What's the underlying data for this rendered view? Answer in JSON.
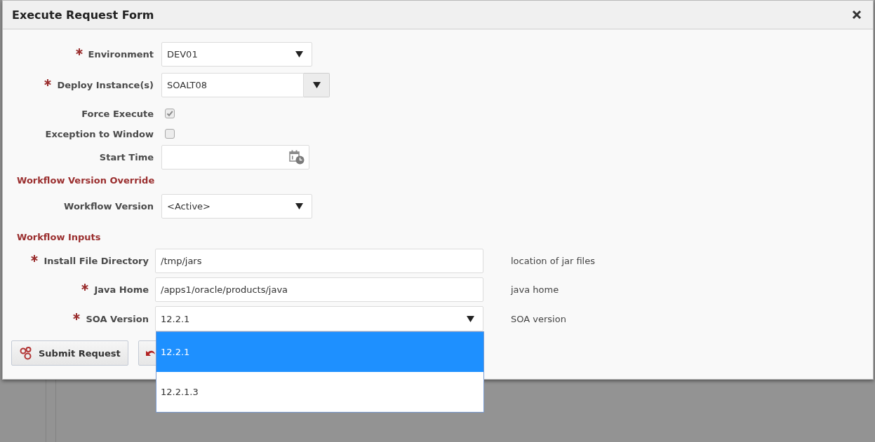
{
  "dialog": {
    "title": "Execute Request Form"
  },
  "main_fields": [
    {
      "kind": "select",
      "label": "Environment",
      "required": true,
      "value": "DEV01"
    },
    {
      "kind": "combo",
      "label": "Deploy Instance(s)",
      "required": true,
      "value": "SOALT08"
    },
    {
      "kind": "checkbox",
      "label": "Force Execute",
      "required": false,
      "checked": true
    },
    {
      "kind": "checkbox",
      "label": "Exception to Window",
      "required": false,
      "checked": false
    },
    {
      "kind": "datetime",
      "label": "Start Time",
      "required": false
    }
  ],
  "version_override": {
    "heading": "Workflow Version Override",
    "fields": [
      {
        "kind": "select",
        "label": "Workflow Version",
        "required": false,
        "value": "<Active>"
      }
    ]
  },
  "workflow_inputs": {
    "heading": "Workflow Inputs",
    "fields": [
      {
        "kind": "text",
        "label": "Install File Directory",
        "required": true,
        "value": "/tmp/jars",
        "hint": "location of jar files"
      },
      {
        "kind": "text",
        "label": "Java Home",
        "required": true,
        "value": "/apps1/oracle/products/java",
        "hint": "java home"
      },
      {
        "kind": "select",
        "label": "SOA Version",
        "required": true,
        "value": "12.2.1",
        "hint": "SOA version",
        "expanded": true,
        "options": [
          {
            "label": "12.2.1",
            "selected": true
          },
          {
            "label": "12.2.1.3",
            "selected": false
          }
        ]
      }
    ]
  },
  "buttons": [
    {
      "kind": "submit",
      "label": "Submit Request"
    },
    {
      "kind": "undo"
    }
  ]
}
